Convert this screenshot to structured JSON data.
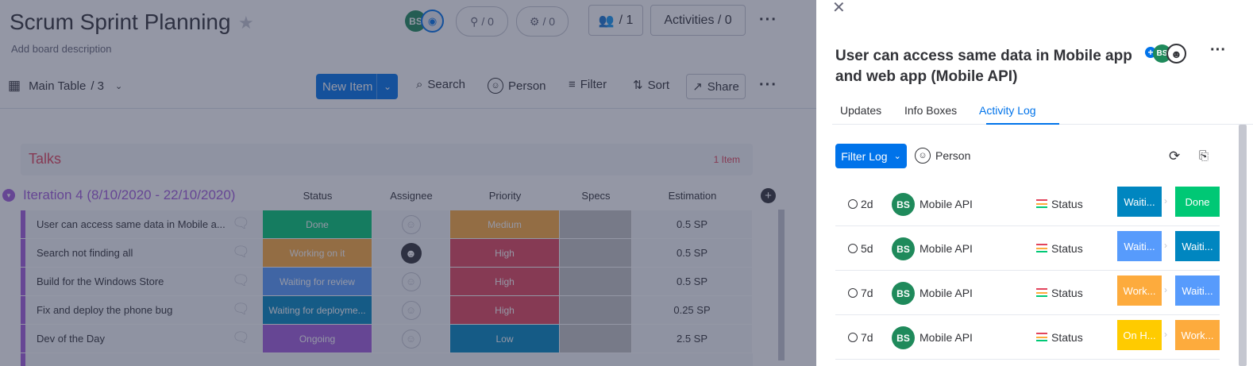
{
  "board": {
    "title": "Scrum Sprint Planning",
    "description": "Add board description",
    "avatar_initials": "BS",
    "integrations_count": "/ 0",
    "automations_count": "/ 0",
    "members_label": "/ 1",
    "activities_label": "Activities / 0"
  },
  "toolbar": {
    "view_label": "Main Table",
    "view_count": "/ 3",
    "new_item": "New Item",
    "search": "Search",
    "person": "Person",
    "filter": "Filter",
    "sort": "Sort",
    "share": "Share"
  },
  "groups": {
    "talks": {
      "title": "Talks",
      "count": "1 Item"
    },
    "iteration": {
      "title": "Iteration 4 (8/10/2020 - 22/10/2020)"
    }
  },
  "columns": [
    "Status",
    "Assignee",
    "Priority",
    "Specs",
    "Estimation"
  ],
  "rows": [
    {
      "name": "User can access same data in Mobile a...",
      "status": "Done",
      "status_color": "#00c875",
      "assignee": "empty",
      "priority": "Medium",
      "priority_color": "#fdab3d",
      "estimation": "0.5 SP"
    },
    {
      "name": "Search not finding all",
      "status": "Working on it",
      "status_color": "#fdab3d",
      "assignee": "person",
      "priority": "High",
      "priority_color": "#e2445c",
      "estimation": "0.5 SP"
    },
    {
      "name": "Build for the Windows Store",
      "status": "Waiting for review",
      "status_color": "#579bfc",
      "assignee": "empty",
      "priority": "High",
      "priority_color": "#e2445c",
      "estimation": "0.5 SP"
    },
    {
      "name": "Fix and deploy the phone bug",
      "status": "Waiting for deployme...",
      "status_color": "#0086c0",
      "assignee": "empty",
      "priority": "High",
      "priority_color": "#e2445c",
      "estimation": "0.25 SP"
    },
    {
      "name": "Dev of the Day",
      "status": "Ongoing",
      "status_color": "#a25ddc",
      "assignee": "empty",
      "priority": "Low",
      "priority_color": "#0086c0",
      "estimation": "2.5 SP"
    }
  ],
  "panel": {
    "title": "User can access same data in Mobile app and web app (Mobile API)",
    "avatar_initials": "BS",
    "tabs": [
      "Updates",
      "Info Boxes",
      "Activity Log"
    ],
    "active_tab": "Activity Log",
    "filter_log": "Filter Log",
    "person": "Person",
    "log": [
      {
        "time": "2d",
        "item": "Mobile API",
        "column": "Status",
        "from": "Waiti...",
        "from_color": "#0086c0",
        "to": "Done",
        "to_color": "#00c875"
      },
      {
        "time": "5d",
        "item": "Mobile API",
        "column": "Status",
        "from": "Waiti...",
        "from_color": "#579bfc",
        "to": "Waiti...",
        "to_color": "#0086c0"
      },
      {
        "time": "7d",
        "item": "Mobile API",
        "column": "Status",
        "from": "Work...",
        "from_color": "#fdab3d",
        "to": "Waiti...",
        "to_color": "#579bfc"
      },
      {
        "time": "7d",
        "item": "Mobile API",
        "column": "Status",
        "from": "On H...",
        "from_color": "#ffcb00",
        "to": "Work...",
        "to_color": "#fdab3d"
      }
    ]
  },
  "colors": {
    "accent": "#0073ea",
    "iteration_purple": "#a25ddc",
    "talks_red": "#e2445c",
    "specs_gray": "#c4c4c4"
  }
}
